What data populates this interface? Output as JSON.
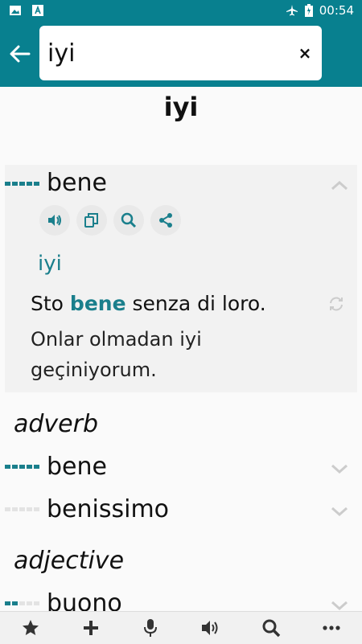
{
  "status": {
    "time": "00:54"
  },
  "search": {
    "value": "iyi"
  },
  "headword": "iyi",
  "entries": {
    "expanded": {
      "word": "bene",
      "translation": "iyi",
      "example_before": "Sto ",
      "example_bold": "bene",
      "example_after": " senza di loro.",
      "example_translation": "Onlar olmadan iyi geçiniyorum."
    },
    "adverb": {
      "pos": "adverb",
      "words": [
        "bene",
        "benissimo"
      ]
    },
    "adjective": {
      "pos": "adjective",
      "words": [
        "buono"
      ]
    }
  },
  "icons": {
    "status_left": [
      "image-icon",
      "font-icon"
    ],
    "status_right": [
      "airplane-icon",
      "battery-icon"
    ],
    "actions": [
      "speaker-icon",
      "copy-icon",
      "search-icon",
      "share-icon"
    ],
    "bottom_bar": [
      "star-icon",
      "plus-icon",
      "microphone-icon",
      "speaker-icon",
      "search-icon",
      "more-icon"
    ]
  },
  "colors": {
    "primary": "#08808f",
    "accent": "#1a7f8c"
  }
}
